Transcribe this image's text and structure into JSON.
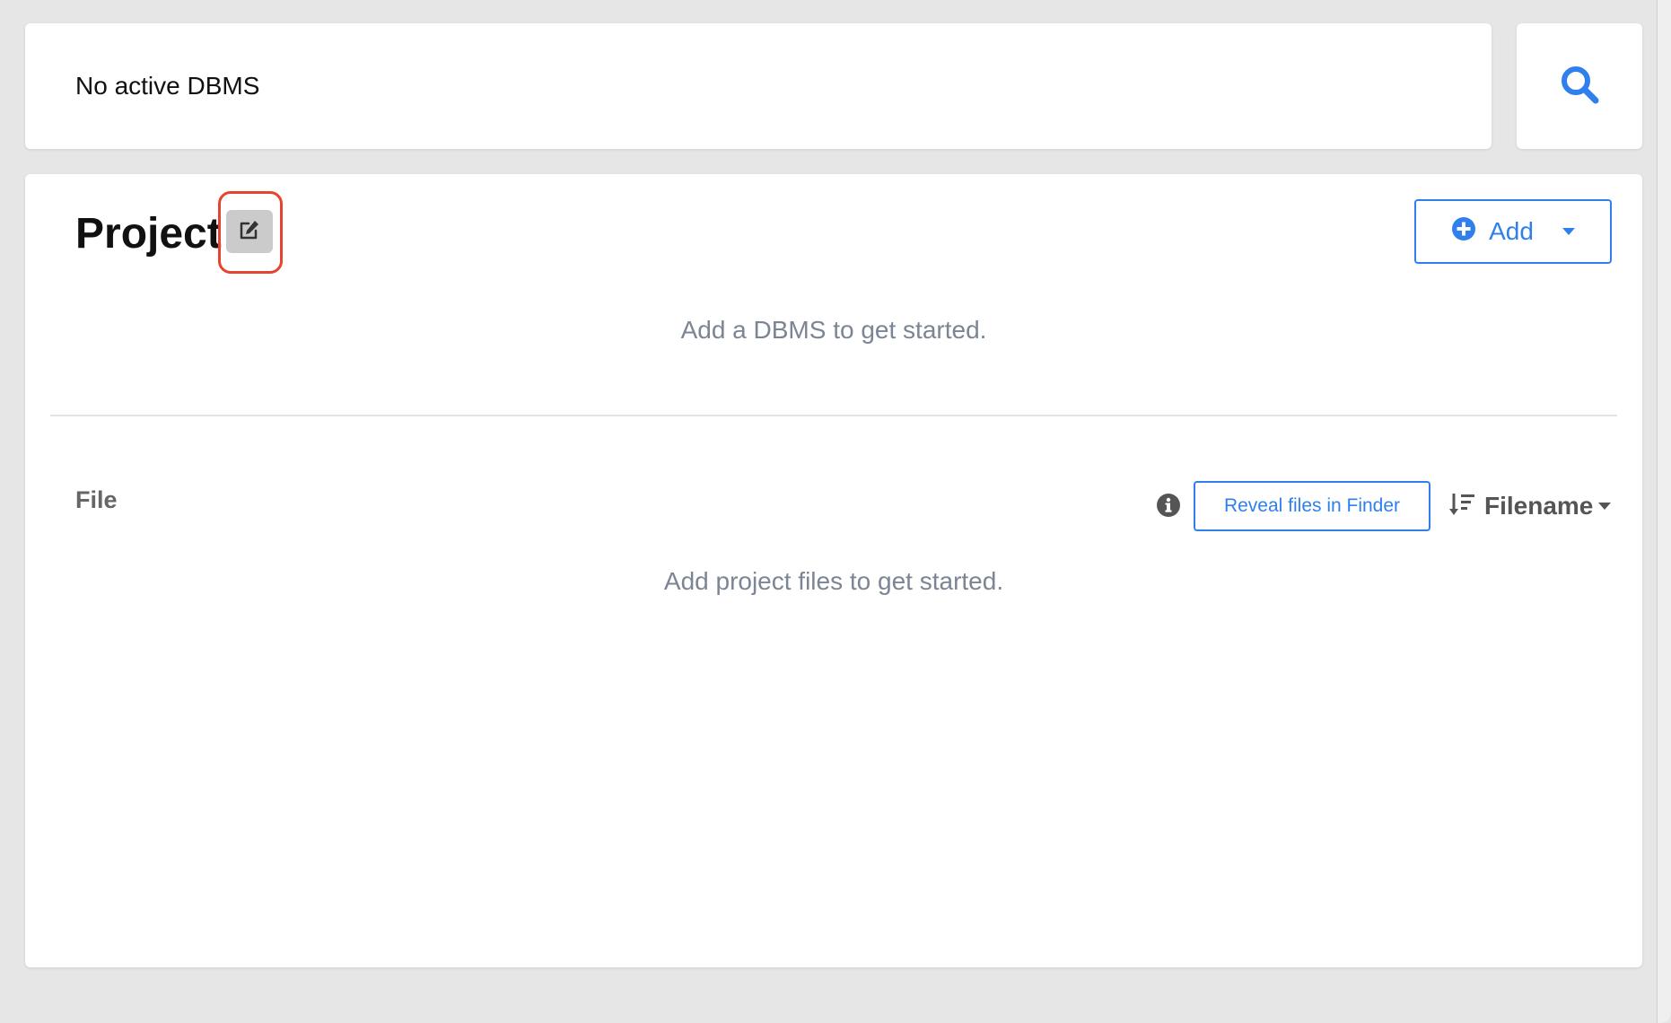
{
  "topbar": {
    "status_text": "No active DBMS"
  },
  "search": {
    "icon": "search-icon"
  },
  "project": {
    "title": "Project",
    "edit_icon": "edit-icon",
    "add_button_label": "Add",
    "empty_dbms_text": "Add a DBMS to get started."
  },
  "files": {
    "section_label": "File",
    "info_icon": "info-icon",
    "reveal_button_label": "Reveal files in Finder",
    "sort_label": "Filename",
    "sort_icon": "sort-descending-icon",
    "empty_files_text": "Add project files to get started."
  },
  "colors": {
    "accent": "#2f80ed",
    "highlight": "#e5452c",
    "muted_text": "#7b8593"
  }
}
